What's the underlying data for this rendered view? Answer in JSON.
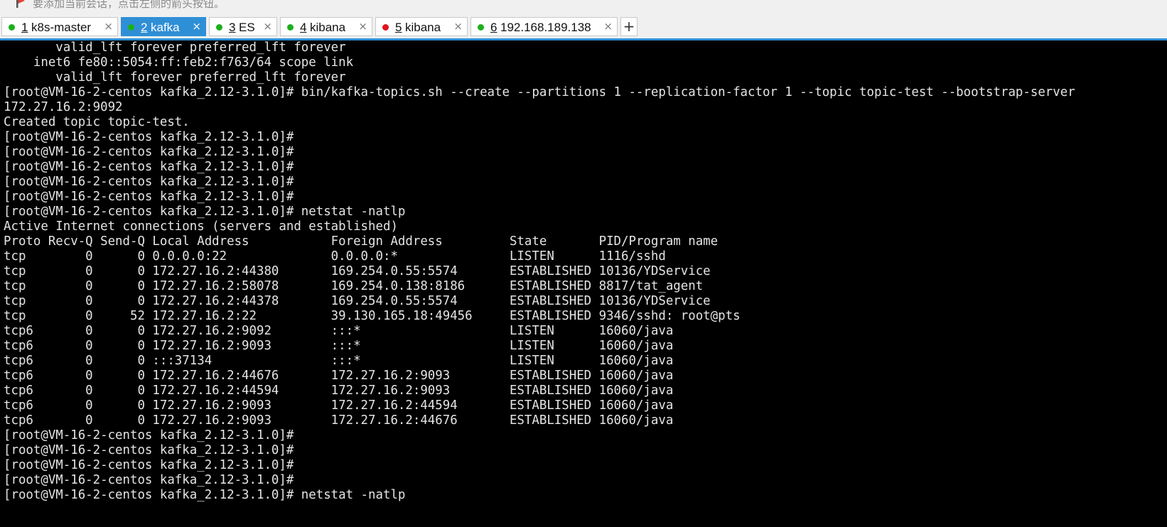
{
  "hint_bar": {
    "text": "要添加当前会话，点击左侧的箭头按钮。",
    "icon": "arrow-flag-icon"
  },
  "tabs": [
    {
      "number": "1",
      "label": "k8s-master",
      "status_color": "#1bb01b",
      "active": false
    },
    {
      "number": "2",
      "label": "kafka",
      "status_color": "#1bb01b",
      "active": true
    },
    {
      "number": "3",
      "label": "ES",
      "status_color": "#1bb01b",
      "active": false
    },
    {
      "number": "4",
      "label": "kibana",
      "status_color": "#1bb01b",
      "active": false
    },
    {
      "number": "5",
      "label": "kibana",
      "status_color": "#e0141e",
      "active": false
    },
    {
      "number": "6",
      "label": "192.168.189.138",
      "status_color": "#1bb01b",
      "active": false
    }
  ],
  "tab_close_glyph": "×",
  "add_tab_glyph": "+",
  "colors": {
    "accent": "#2f8fd6",
    "terminal_bg": "#000000",
    "terminal_fg": "#e4e4e4"
  },
  "terminal_lines": [
    "       valid_lft forever preferred_lft forever",
    "    inet6 fe80::5054:ff:feb2:f763/64 scope link",
    "       valid_lft forever preferred_lft forever",
    "[root@VM-16-2-centos kafka_2.12-3.1.0]# bin/kafka-topics.sh --create --partitions 1 --replication-factor 1 --topic topic-test --bootstrap-server",
    "172.27.16.2:9092",
    "Created topic topic-test.",
    "[root@VM-16-2-centos kafka_2.12-3.1.0]#",
    "[root@VM-16-2-centos kafka_2.12-3.1.0]#",
    "[root@VM-16-2-centos kafka_2.12-3.1.0]#",
    "[root@VM-16-2-centos kafka_2.12-3.1.0]#",
    "[root@VM-16-2-centos kafka_2.12-3.1.0]#",
    "[root@VM-16-2-centos kafka_2.12-3.1.0]# netstat -natlp",
    "Active Internet connections (servers and established)",
    "Proto Recv-Q Send-Q Local Address           Foreign Address         State       PID/Program name",
    "tcp        0      0 0.0.0.0:22              0.0.0.0:*               LISTEN      1116/sshd",
    "tcp        0      0 172.27.16.2:44380       169.254.0.55:5574       ESTABLISHED 10136/YDService",
    "tcp        0      0 172.27.16.2:58078       169.254.0.138:8186      ESTABLISHED 8817/tat_agent",
    "tcp        0      0 172.27.16.2:44378       169.254.0.55:5574       ESTABLISHED 10136/YDService",
    "tcp        0     52 172.27.16.2:22          39.130.165.18:49456     ESTABLISHED 9346/sshd: root@pts",
    "tcp6       0      0 172.27.16.2:9092        :::*                    LISTEN      16060/java",
    "tcp6       0      0 172.27.16.2:9093        :::*                    LISTEN      16060/java",
    "tcp6       0      0 :::37134                :::*                    LISTEN      16060/java",
    "tcp6       0      0 172.27.16.2:44676       172.27.16.2:9093        ESTABLISHED 16060/java",
    "tcp6       0      0 172.27.16.2:44594       172.27.16.2:9093        ESTABLISHED 16060/java",
    "tcp6       0      0 172.27.16.2:9093        172.27.16.2:44594       ESTABLISHED 16060/java",
    "tcp6       0      0 172.27.16.2:9093        172.27.16.2:44676       ESTABLISHED 16060/java",
    "[root@VM-16-2-centos kafka_2.12-3.1.0]#",
    "[root@VM-16-2-centos kafka_2.12-3.1.0]#",
    "[root@VM-16-2-centos kafka_2.12-3.1.0]#",
    "[root@VM-16-2-centos kafka_2.12-3.1.0]#",
    "[root@VM-16-2-centos kafka_2.12-3.1.0]# netstat -natlp"
  ]
}
